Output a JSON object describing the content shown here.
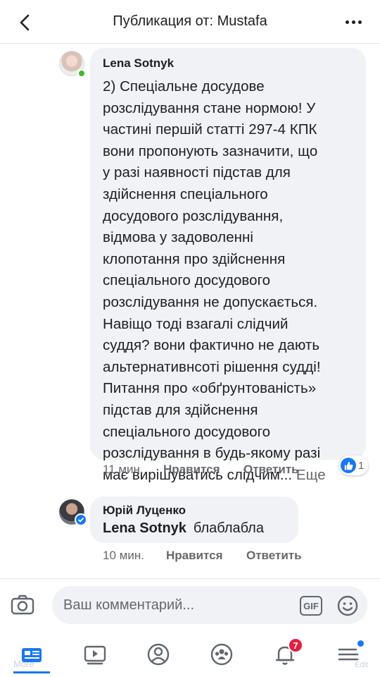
{
  "header": {
    "title": "Публикация от: Mustafa",
    "back_icon": "back-arrow-icon",
    "more_icon": "more-horizontal-icon"
  },
  "comments": [
    {
      "author": "Lena Sotnyk",
      "text": "2) Спеціальне досудове\nрозслідування стане нормою!  У\nчастині першій статті 297-4 КПК\nвони пропонують зазначити, що\nу разі наявності підстав для\nздійснення спеціального\nдосудового розслідування,\nвідмова у задоволенні\nклопотання про здійснення\nспеціального досудового\nрозслідування не допускається.\nНавіщо тоді взагалі слідчий\nсуддя? вони фактично не дають\nальтернативнсоті рішення судді!\nПитання про «обґрунтованість»\nпідстав для  здійснення\nспеціального досудового\nрозслідування в будь-якому разі\nмає вирішуватись слідчим...",
      "see_more": "Еще",
      "time": "11 мин.",
      "like_label": "Нравится",
      "reply_label": "Ответить",
      "reaction_count": "1"
    },
    {
      "author": "Юрій Луценко",
      "mention": "Lena Sotnyk",
      "text": "блаблабла",
      "time": "10 мин.",
      "like_label": "Нравится",
      "reply_label": "Ответить"
    }
  ],
  "composer": {
    "placeholder": "Ваш комментарий...",
    "gif_label": "GIF"
  },
  "bottom_nav": {
    "notifications_badge": "7",
    "more_label": "More",
    "edit_label": "Edit"
  },
  "colors": {
    "accent": "#1877f2",
    "bubble": "#f0f2f5",
    "secondary_text": "#65676b",
    "badge": "#e41e3f"
  }
}
